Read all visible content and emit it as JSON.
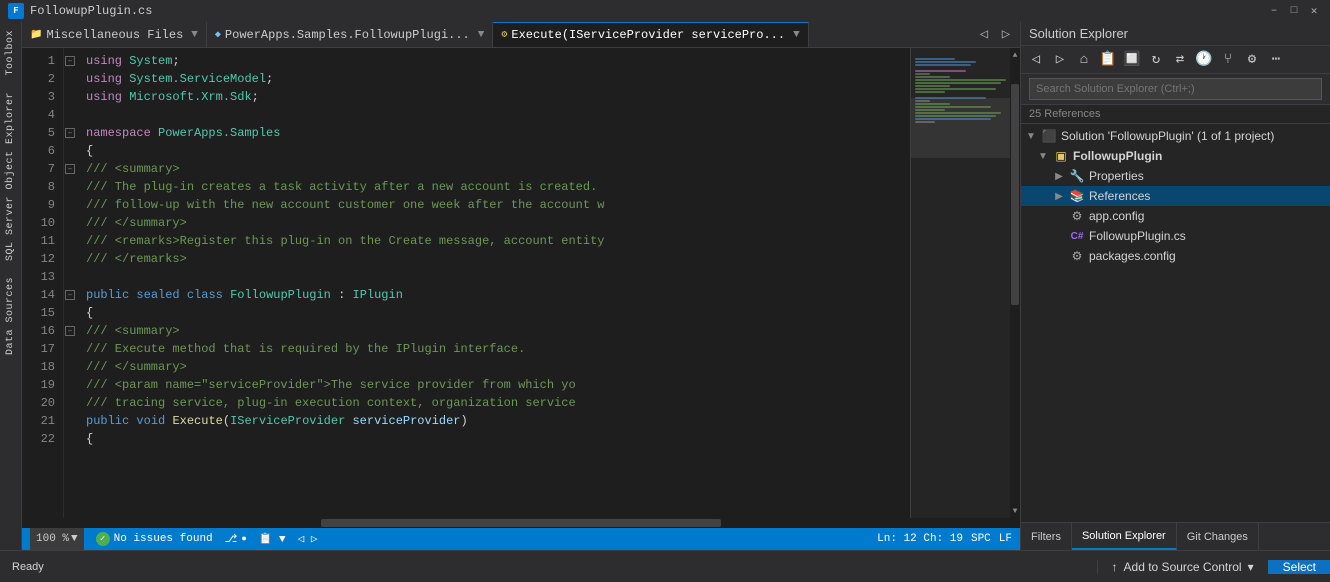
{
  "titleBar": {
    "filename": "FollowupPlugin.cs",
    "closeBtn": "✕",
    "pinBtn": "–"
  },
  "tabs": [
    {
      "id": "misc",
      "label": "Miscellaneous Files",
      "icon": "📁",
      "active": false
    },
    {
      "id": "powerapps",
      "label": "PowerApps.Samples.FollowupPlugi...",
      "icon": "🔷",
      "active": false
    },
    {
      "id": "execute",
      "label": "Execute(IServiceProvider servicePro...",
      "icon": "⚙",
      "active": true
    }
  ],
  "tabActions": {
    "moveLeft": "◁",
    "moveRight": "▷"
  },
  "codeLines": [
    {
      "num": "1",
      "indent": 0,
      "content": "using System;"
    },
    {
      "num": "2",
      "indent": 0,
      "content": "using System.ServiceModel;"
    },
    {
      "num": "3",
      "indent": 0,
      "content": "using Microsoft.Xrm.Sdk;"
    },
    {
      "num": "4",
      "indent": 0,
      "content": ""
    },
    {
      "num": "5",
      "indent": 0,
      "content": "namespace PowerApps.Samples"
    },
    {
      "num": "6",
      "indent": 1,
      "content": "{"
    },
    {
      "num": "7",
      "indent": 2,
      "content": "/// <summary>"
    },
    {
      "num": "8",
      "indent": 2,
      "content": "/// The plug-in creates a task activity after a new account is created."
    },
    {
      "num": "9",
      "indent": 2,
      "content": "/// follow-up with the new account customer one week after the account w"
    },
    {
      "num": "10",
      "indent": 2,
      "content": "/// </summary>"
    },
    {
      "num": "11",
      "indent": 2,
      "content": "/// <remarks>Register this plug-in on the Create message, account entity"
    },
    {
      "num": "12",
      "indent": 2,
      "content": "/// </remarks>"
    },
    {
      "num": "13",
      "indent": 0,
      "content": ""
    },
    {
      "num": "14",
      "indent": 2,
      "content": "public sealed class FollowupPlugin : IPlugin"
    },
    {
      "num": "15",
      "indent": 2,
      "content": "{"
    },
    {
      "num": "16",
      "indent": 3,
      "content": "/// <summary>"
    },
    {
      "num": "17",
      "indent": 3,
      "content": "/// Execute method that is required by the IPlugin interface."
    },
    {
      "num": "18",
      "indent": 3,
      "content": "/// </summary>"
    },
    {
      "num": "19",
      "indent": 3,
      "content": "/// <param name=\"serviceProvider\">The service provider from which yo"
    },
    {
      "num": "20",
      "indent": 3,
      "content": "/// tracing service, plug-in execution context, organization service"
    },
    {
      "num": "21",
      "indent": 3,
      "content": "public void Execute(IServiceProvider serviceProvider)"
    },
    {
      "num": "22",
      "indent": 3,
      "content": "{"
    }
  ],
  "statusBar": {
    "zoom": "100 %",
    "zoomDropdown": "▼",
    "healthIcon": "✓",
    "healthText": "No issues found",
    "branchIcon": "⎇",
    "lineCol": "Ln: 12  Ch: 19",
    "encoding": "SPC",
    "lineEnding": "LF"
  },
  "solutionExplorer": {
    "title": "Solution Explorer",
    "searchPlaceholder": "Search Solution Explorer (Ctrl+;)",
    "refsCount": "25 References",
    "tree": {
      "solution": "Solution 'FollowupPlugin' (1 of 1 project)",
      "project": "FollowupPlugin",
      "items": [
        {
          "id": "properties",
          "label": "Properties",
          "icon": "🔧",
          "depth": 1,
          "expandable": true
        },
        {
          "id": "references",
          "label": "References",
          "icon": "📚",
          "depth": 1,
          "expandable": true,
          "selected": true
        },
        {
          "id": "appconfig",
          "label": "app.config",
          "icon": "⚙",
          "depth": 1,
          "expandable": false
        },
        {
          "id": "followupplugin-cs",
          "label": "FollowupPlugin.cs",
          "icon": "C#",
          "depth": 1,
          "expandable": false
        },
        {
          "id": "packages-config",
          "label": "packages.config",
          "icon": "📦",
          "depth": 1,
          "expandable": false
        }
      ]
    },
    "bottomTabs": [
      {
        "id": "filters",
        "label": "Filters",
        "active": false
      },
      {
        "id": "solution-explorer",
        "label": "Solution Explorer",
        "active": true
      },
      {
        "id": "git-changes",
        "label": "Git Changes",
        "active": false
      }
    ]
  },
  "footer": {
    "readyText": "Ready",
    "addToSourceControl": "Add to Source Control",
    "selectLabel": "Select",
    "upArrow": "↑",
    "dropdownArrow": "▾"
  },
  "leftSidebar": {
    "items": [
      "Toolbox",
      "SQL Server Object Explorer",
      "Data Sources"
    ]
  }
}
